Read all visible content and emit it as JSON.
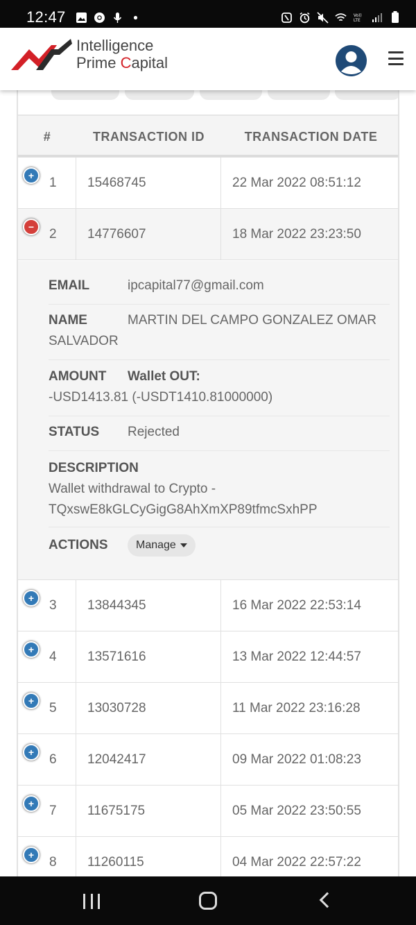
{
  "status_bar": {
    "time": "12:47",
    "left_icons": [
      "image-icon",
      "chrome-icon",
      "mic-icon",
      "dot-icon"
    ],
    "right_icons": [
      "nfc-icon",
      "alarm-icon",
      "mute-icon",
      "wifi-icon",
      "volte-icon",
      "signal-icon",
      "battery-icon"
    ]
  },
  "header": {
    "brand_line1": "Intelligence",
    "brand_line2_a": "Prime ",
    "brand_line2_b": "C",
    "brand_line2_c": "apital",
    "brand_accent": "#d32027",
    "avatar_color": "#1f4a77"
  },
  "table": {
    "headers": {
      "num": "#",
      "id": "TRANSACTION ID",
      "date": "TRANSACTION DATE"
    },
    "rows_before": [
      {
        "num": "1",
        "id": "15468745",
        "date": "22 Mar 2022 08:51:12",
        "toggle": "+"
      },
      {
        "num": "2",
        "id": "14776607",
        "date": "18 Mar 2022 23:23:50",
        "toggle": "−"
      }
    ],
    "rows_after": [
      {
        "num": "3",
        "id": "13844345",
        "date": "16 Mar 2022 22:53:14",
        "toggle": "+"
      },
      {
        "num": "4",
        "id": "13571616",
        "date": "13 Mar 2022 12:44:57",
        "toggle": "+"
      },
      {
        "num": "5",
        "id": "13030728",
        "date": "11 Mar 2022 23:16:28",
        "toggle": "+"
      },
      {
        "num": "6",
        "id": "12042417",
        "date": "09 Mar 2022 01:08:23",
        "toggle": "+"
      },
      {
        "num": "7",
        "id": "11675175",
        "date": "05 Mar 2022 23:50:55",
        "toggle": "+"
      },
      {
        "num": "8",
        "id": "11260115",
        "date": "04 Mar 2022 22:57:22",
        "toggle": "+"
      }
    ]
  },
  "details": {
    "email_label": "EMAIL",
    "email_value": "ipcapital77@gmail.com",
    "name_label": "NAME",
    "name_value": "MARTIN DEL CAMPO GONZALEZ OMAR SALVADOR",
    "amount_label": "AMOUNT",
    "amount_value_bold": "Wallet OUT:",
    "amount_value": "-USD1413.81 (-USDT1410.81000000)",
    "status_label": "STATUS",
    "status_value": "Rejected",
    "description_label": "DESCRIPTION",
    "description_value": "Wallet withdrawal to Crypto - TQxswE8kGLCyGigG8AhXmXP89tfmcSxhPP",
    "actions_label": "ACTIONS",
    "manage_label": "Manage"
  },
  "colors": {
    "plus": "#337ab7",
    "minus": "#d43f3a"
  }
}
